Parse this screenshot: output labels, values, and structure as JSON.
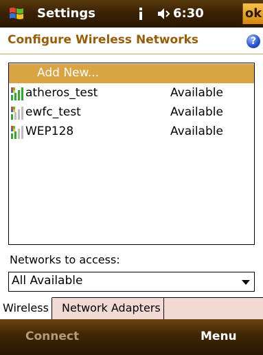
{
  "titlebar": {
    "title": "Settings",
    "time": "6:30",
    "ok_label": "ok"
  },
  "header": {
    "title": "Configure Wireless Networks",
    "help_label": "?"
  },
  "networks": {
    "add_new": "Add New...",
    "items": [
      {
        "name": "atheros_test",
        "status": "Available",
        "signal": 3
      },
      {
        "name": "ewfc_test",
        "status": "Available",
        "signal": 1
      },
      {
        "name": "WEP128",
        "status": "Available",
        "signal": 2
      }
    ]
  },
  "access": {
    "label": "Networks to access:",
    "selected": "All Available"
  },
  "tabs": [
    {
      "label": "Wireless"
    },
    {
      "label": "Network Adapters"
    }
  ],
  "softkeys": {
    "left": "Connect",
    "right": "Menu"
  },
  "colors": {
    "accent": "#d9a441",
    "header_text": "#9a5c07"
  }
}
